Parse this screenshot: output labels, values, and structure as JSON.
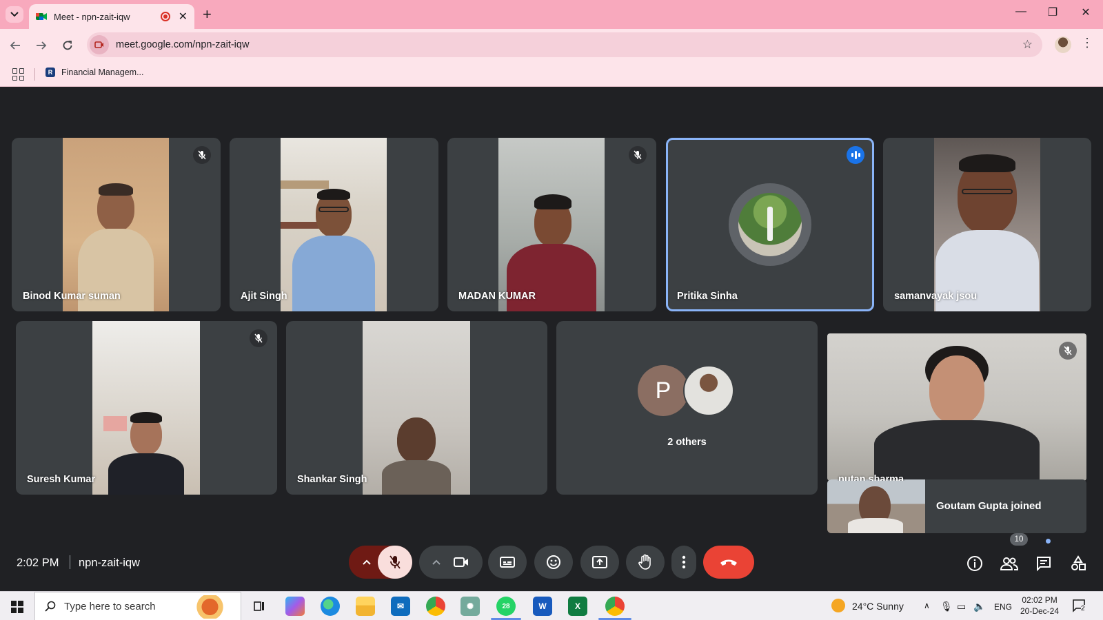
{
  "browser": {
    "tab": {
      "title": "Meet - npn-zait-iqw",
      "close": "✕"
    },
    "new_tab": "+",
    "window_controls": [
      "—",
      "❐",
      "✕"
    ],
    "url": "meet.google.com/npn-zait-iqw",
    "bookmark": "Financial Managem..."
  },
  "meeting": {
    "time": "2:02 PM",
    "code": "npn-zait-iqw",
    "participants_count": "10",
    "tiles_row1": [
      {
        "name": "Binod Kumar suman",
        "muted": true
      },
      {
        "name": "Ajit Singh",
        "muted": false
      },
      {
        "name": "MADAN KUMAR",
        "muted": true
      },
      {
        "name": "Pritika Sinha",
        "speaking": true
      },
      {
        "name": "samanvayak jsou",
        "muted": false
      }
    ],
    "tiles_row2": [
      {
        "name": "Suresh Kumar",
        "muted": true
      },
      {
        "name": "Shankar Singh",
        "muted": false
      },
      {
        "name": "2 others",
        "initial": "P"
      },
      {
        "name": "nutan sharma",
        "muted": true
      }
    ],
    "toast": "Goutam Gupta joined"
  },
  "taskbar": {
    "search_placeholder": "Type here to search",
    "weather": "24°C  Sunny",
    "lang": "ENG",
    "time": "02:02 PM",
    "date": "20-Dec-24",
    "whatsapp_badge": "28",
    "notif_count": "2"
  },
  "colors": {
    "tabstrip": "#f8a9bd",
    "toolbar": "#fde4ea",
    "meet_bg": "#202124",
    "tile": "#3c4043",
    "end_call": "#ea4335",
    "active_outline": "#8ab4f8"
  }
}
